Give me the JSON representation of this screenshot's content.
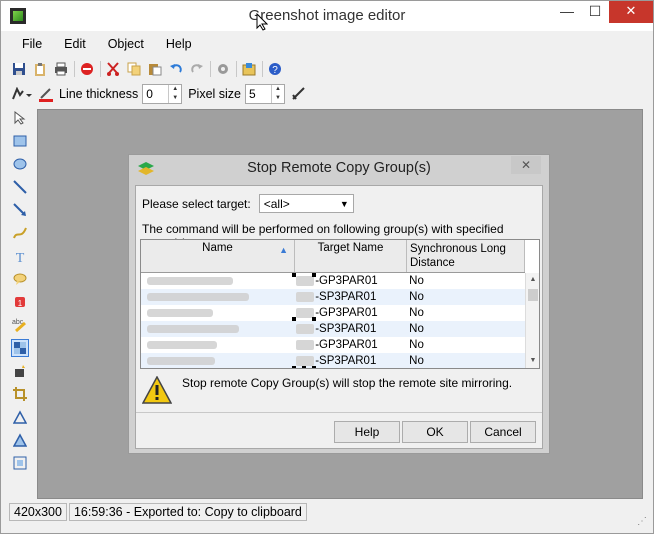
{
  "window": {
    "title": "Greenshot image editor",
    "minimize": "—",
    "maximize": "☐",
    "close": "✕"
  },
  "menu": [
    "File",
    "Edit",
    "Object",
    "Help"
  ],
  "toolbar": {
    "line_thickness_label": "Line thickness",
    "line_thickness_value": "0",
    "pixel_size_label": "Pixel size",
    "pixel_size_value": "5"
  },
  "status": {
    "size": "420x300",
    "message": "16:59:36 - Exported to: Copy to clipboard"
  },
  "dialog": {
    "title": "Stop Remote Copy Group(s)",
    "close": "✕",
    "target_label": "Please select target:",
    "target_value": "<all>",
    "command_note": "The command will be performed on following group(s) with specified target(s).",
    "columns": {
      "name": "Name",
      "target": "Target Name",
      "sync": "Synchronous Long Distance"
    },
    "rows": [
      {
        "target": "-GP3PAR01",
        "sync": "No"
      },
      {
        "target": "-SP3PAR01",
        "sync": "No"
      },
      {
        "target": "-GP3PAR01",
        "sync": "No"
      },
      {
        "target": "-SP3PAR01",
        "sync": "No"
      },
      {
        "target": "-GP3PAR01",
        "sync": "No"
      },
      {
        "target": "-SP3PAR01",
        "sync": "No"
      }
    ],
    "warning": "Stop remote Copy Group(s) will stop the remote site mirroring.",
    "buttons": {
      "help": "Help",
      "ok": "OK",
      "cancel": "Cancel"
    }
  }
}
